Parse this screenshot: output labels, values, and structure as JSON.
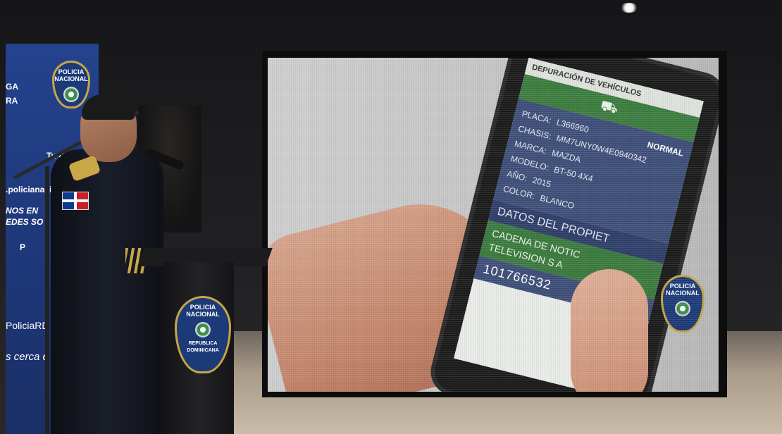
{
  "scene": {
    "banner": {
      "lines": [
        "GA",
        "RA",
        "Tu Poli",
        ".policianaci",
        "NOS EN",
        "EDES SO",
        "P",
        "PoliciaRD",
        "s cerca e",
        "Tr"
      ],
      "seal_text": "POLICIA NACIONAL"
    },
    "podium": {
      "seal_text": "POLICIA NACIONAL",
      "seal_subtext": "REPUBLICA DOMINICANA"
    },
    "phone": {
      "header": "DEPURACIÓN DE VEHÍCULOS",
      "fields": [
        {
          "label": "PLACA:",
          "value": "L366960",
          "status": "NORMAL"
        },
        {
          "label": "CHASIS:",
          "value": "MM7UNY0W4E0940342"
        },
        {
          "label": "MARCA:",
          "value": "MAZDA"
        },
        {
          "label": "MODELO:",
          "value": "BT-50 4X4"
        },
        {
          "label": "AÑO:",
          "value": "2015"
        },
        {
          "label": "COLOR:",
          "value": "BLANCO"
        }
      ],
      "owner_title": "DATOS DEL PROPIET",
      "owner_lines": [
        "CADENA DE NOTIC",
        "TELEVISION S A"
      ],
      "owner_id": "101766532"
    },
    "screen_seal_text": "POLICIA NACIONAL",
    "colors": {
      "police_blue": "#1c3a78",
      "gold": "#c9a646",
      "app_green": "#3c7d3f",
      "app_navy": "#3e4f79"
    }
  }
}
